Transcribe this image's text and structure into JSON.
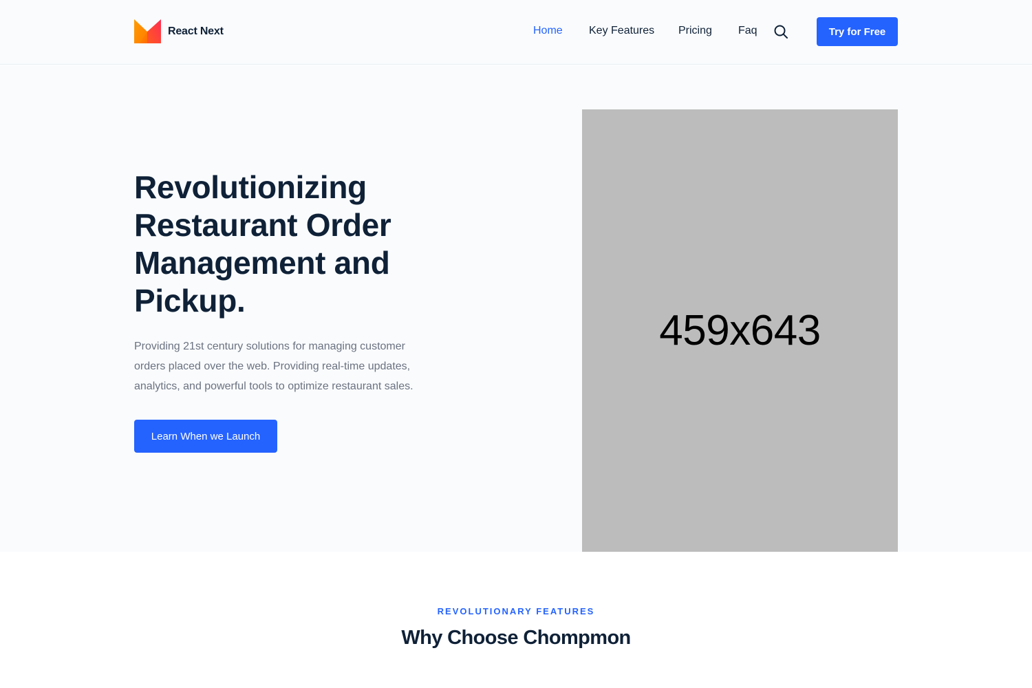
{
  "header": {
    "brand": "React Next",
    "nav": [
      {
        "label": "Home",
        "active": true
      },
      {
        "label": "Key Features",
        "active": false
      },
      {
        "label": "Pricing",
        "active": false
      },
      {
        "label": "Faq",
        "active": false
      }
    ],
    "search_icon": "search-icon",
    "cta_label": "Try for Free"
  },
  "hero": {
    "title": "Revolutionizing Restaurant Order Management and Pickup.",
    "description": "Providing 21st century solutions for managing customer orders placed over the web. Providing real-time updates, analytics, and powerful tools to optimize restaurant sales.",
    "button_label": "Learn When we Launch",
    "image_placeholder": "459x643"
  },
  "features": {
    "kicker": "REVOLUTIONARY FEATURES",
    "title": "Why Choose Chompmon"
  },
  "colors": {
    "accent": "#2563ff",
    "heading": "#0f2137",
    "body_text": "#6b7280",
    "hero_bg": "#f9fbfd",
    "placeholder_bg": "#bcbcbc"
  }
}
